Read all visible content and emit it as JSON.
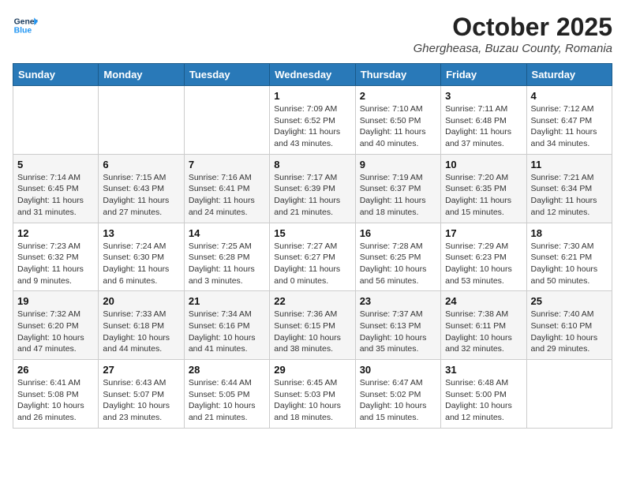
{
  "header": {
    "logo_general": "General",
    "logo_blue": "Blue",
    "month": "October 2025",
    "location": "Ghergheasa, Buzau County, Romania"
  },
  "weekdays": [
    "Sunday",
    "Monday",
    "Tuesday",
    "Wednesday",
    "Thursday",
    "Friday",
    "Saturday"
  ],
  "weeks": [
    [
      {
        "day": "",
        "info": ""
      },
      {
        "day": "",
        "info": ""
      },
      {
        "day": "",
        "info": ""
      },
      {
        "day": "1",
        "info": "Sunrise: 7:09 AM\nSunset: 6:52 PM\nDaylight: 11 hours\nand 43 minutes."
      },
      {
        "day": "2",
        "info": "Sunrise: 7:10 AM\nSunset: 6:50 PM\nDaylight: 11 hours\nand 40 minutes."
      },
      {
        "day": "3",
        "info": "Sunrise: 7:11 AM\nSunset: 6:48 PM\nDaylight: 11 hours\nand 37 minutes."
      },
      {
        "day": "4",
        "info": "Sunrise: 7:12 AM\nSunset: 6:47 PM\nDaylight: 11 hours\nand 34 minutes."
      }
    ],
    [
      {
        "day": "5",
        "info": "Sunrise: 7:14 AM\nSunset: 6:45 PM\nDaylight: 11 hours\nand 31 minutes."
      },
      {
        "day": "6",
        "info": "Sunrise: 7:15 AM\nSunset: 6:43 PM\nDaylight: 11 hours\nand 27 minutes."
      },
      {
        "day": "7",
        "info": "Sunrise: 7:16 AM\nSunset: 6:41 PM\nDaylight: 11 hours\nand 24 minutes."
      },
      {
        "day": "8",
        "info": "Sunrise: 7:17 AM\nSunset: 6:39 PM\nDaylight: 11 hours\nand 21 minutes."
      },
      {
        "day": "9",
        "info": "Sunrise: 7:19 AM\nSunset: 6:37 PM\nDaylight: 11 hours\nand 18 minutes."
      },
      {
        "day": "10",
        "info": "Sunrise: 7:20 AM\nSunset: 6:35 PM\nDaylight: 11 hours\nand 15 minutes."
      },
      {
        "day": "11",
        "info": "Sunrise: 7:21 AM\nSunset: 6:34 PM\nDaylight: 11 hours\nand 12 minutes."
      }
    ],
    [
      {
        "day": "12",
        "info": "Sunrise: 7:23 AM\nSunset: 6:32 PM\nDaylight: 11 hours\nand 9 minutes."
      },
      {
        "day": "13",
        "info": "Sunrise: 7:24 AM\nSunset: 6:30 PM\nDaylight: 11 hours\nand 6 minutes."
      },
      {
        "day": "14",
        "info": "Sunrise: 7:25 AM\nSunset: 6:28 PM\nDaylight: 11 hours\nand 3 minutes."
      },
      {
        "day": "15",
        "info": "Sunrise: 7:27 AM\nSunset: 6:27 PM\nDaylight: 11 hours\nand 0 minutes."
      },
      {
        "day": "16",
        "info": "Sunrise: 7:28 AM\nSunset: 6:25 PM\nDaylight: 10 hours\nand 56 minutes."
      },
      {
        "day": "17",
        "info": "Sunrise: 7:29 AM\nSunset: 6:23 PM\nDaylight: 10 hours\nand 53 minutes."
      },
      {
        "day": "18",
        "info": "Sunrise: 7:30 AM\nSunset: 6:21 PM\nDaylight: 10 hours\nand 50 minutes."
      }
    ],
    [
      {
        "day": "19",
        "info": "Sunrise: 7:32 AM\nSunset: 6:20 PM\nDaylight: 10 hours\nand 47 minutes."
      },
      {
        "day": "20",
        "info": "Sunrise: 7:33 AM\nSunset: 6:18 PM\nDaylight: 10 hours\nand 44 minutes."
      },
      {
        "day": "21",
        "info": "Sunrise: 7:34 AM\nSunset: 6:16 PM\nDaylight: 10 hours\nand 41 minutes."
      },
      {
        "day": "22",
        "info": "Sunrise: 7:36 AM\nSunset: 6:15 PM\nDaylight: 10 hours\nand 38 minutes."
      },
      {
        "day": "23",
        "info": "Sunrise: 7:37 AM\nSunset: 6:13 PM\nDaylight: 10 hours\nand 35 minutes."
      },
      {
        "day": "24",
        "info": "Sunrise: 7:38 AM\nSunset: 6:11 PM\nDaylight: 10 hours\nand 32 minutes."
      },
      {
        "day": "25",
        "info": "Sunrise: 7:40 AM\nSunset: 6:10 PM\nDaylight: 10 hours\nand 29 minutes."
      }
    ],
    [
      {
        "day": "26",
        "info": "Sunrise: 6:41 AM\nSunset: 5:08 PM\nDaylight: 10 hours\nand 26 minutes."
      },
      {
        "day": "27",
        "info": "Sunrise: 6:43 AM\nSunset: 5:07 PM\nDaylight: 10 hours\nand 23 minutes."
      },
      {
        "day": "28",
        "info": "Sunrise: 6:44 AM\nSunset: 5:05 PM\nDaylight: 10 hours\nand 21 minutes."
      },
      {
        "day": "29",
        "info": "Sunrise: 6:45 AM\nSunset: 5:03 PM\nDaylight: 10 hours\nand 18 minutes."
      },
      {
        "day": "30",
        "info": "Sunrise: 6:47 AM\nSunset: 5:02 PM\nDaylight: 10 hours\nand 15 minutes."
      },
      {
        "day": "31",
        "info": "Sunrise: 6:48 AM\nSunset: 5:00 PM\nDaylight: 10 hours\nand 12 minutes."
      },
      {
        "day": "",
        "info": ""
      }
    ]
  ]
}
